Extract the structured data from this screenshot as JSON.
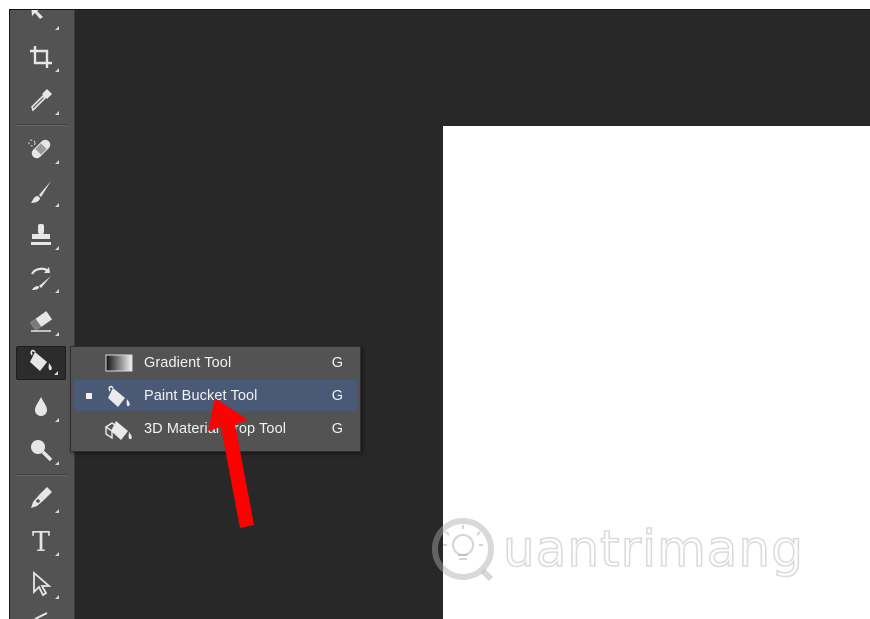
{
  "toolbar": {
    "tools": [
      {
        "name": "move-tool"
      },
      {
        "name": "crop-tool"
      },
      {
        "name": "eyedropper-tool"
      },
      {
        "name": "spot-healing-brush-tool"
      },
      {
        "name": "brush-tool"
      },
      {
        "name": "clone-stamp-tool"
      },
      {
        "name": "history-brush-tool"
      },
      {
        "name": "eraser-tool"
      },
      {
        "name": "paint-bucket-tool",
        "selected": true
      },
      {
        "name": "blur-tool"
      },
      {
        "name": "dodge-tool"
      },
      {
        "name": "pen-tool"
      },
      {
        "name": "type-tool",
        "glyph": "T"
      },
      {
        "name": "path-selection-tool"
      }
    ]
  },
  "flyout": {
    "items": [
      {
        "label": "Gradient Tool",
        "shortcut": "G",
        "icon": "gradient-icon",
        "active": false
      },
      {
        "label": "Paint Bucket Tool",
        "shortcut": "G",
        "icon": "paint-bucket-icon",
        "active": true
      },
      {
        "label": "3D Material Drop Tool",
        "shortcut": "G",
        "icon": "3d-material-drop-icon",
        "active": false
      }
    ]
  },
  "annotation": {
    "arrow_color": "#ff0000"
  },
  "watermark": {
    "text": "uantrimang",
    "color": "#c8c8c8"
  }
}
